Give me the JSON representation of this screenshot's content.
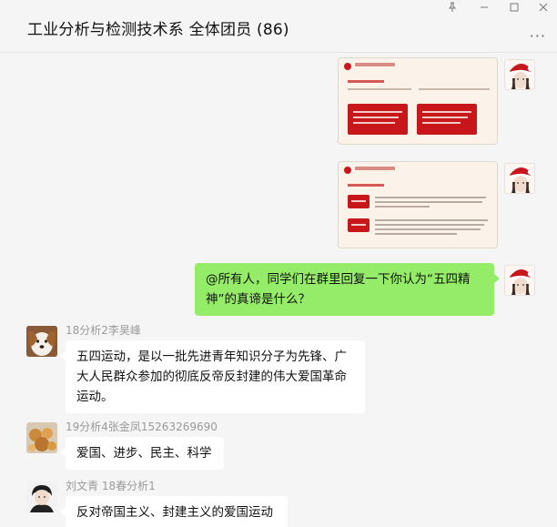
{
  "window": {
    "title": "工业分析与检测技术系 全体团员 (86)",
    "more_label": "···"
  },
  "messages": [
    {
      "type": "image",
      "from": "me",
      "content": "slide-image-1"
    },
    {
      "type": "image",
      "from": "me",
      "content": "slide-image-2"
    },
    {
      "type": "text",
      "from": "me",
      "text_lines": [
        "@所有人，同学们在群里回复一下你认为“五四精",
        "神”的真谛是什么？"
      ]
    },
    {
      "type": "text",
      "from": "other",
      "sender": "18分析2李昊峰",
      "text_lines": [
        "五四运动，是以一批先进青年知识分子为先锋、广",
        "大人民群众参加的彻底反帝反封建的伟大爱国革命",
        "运动。"
      ]
    },
    {
      "type": "text",
      "from": "other",
      "sender": "19分析4张金凤15263269690",
      "text_lines": [
        "爱国、进步、民主、科学"
      ]
    },
    {
      "type": "text",
      "from": "other",
      "sender": "刘文青    18春分析1",
      "text_lines": [
        "反对帝国主义、封建主义的爱国运动"
      ]
    }
  ]
}
